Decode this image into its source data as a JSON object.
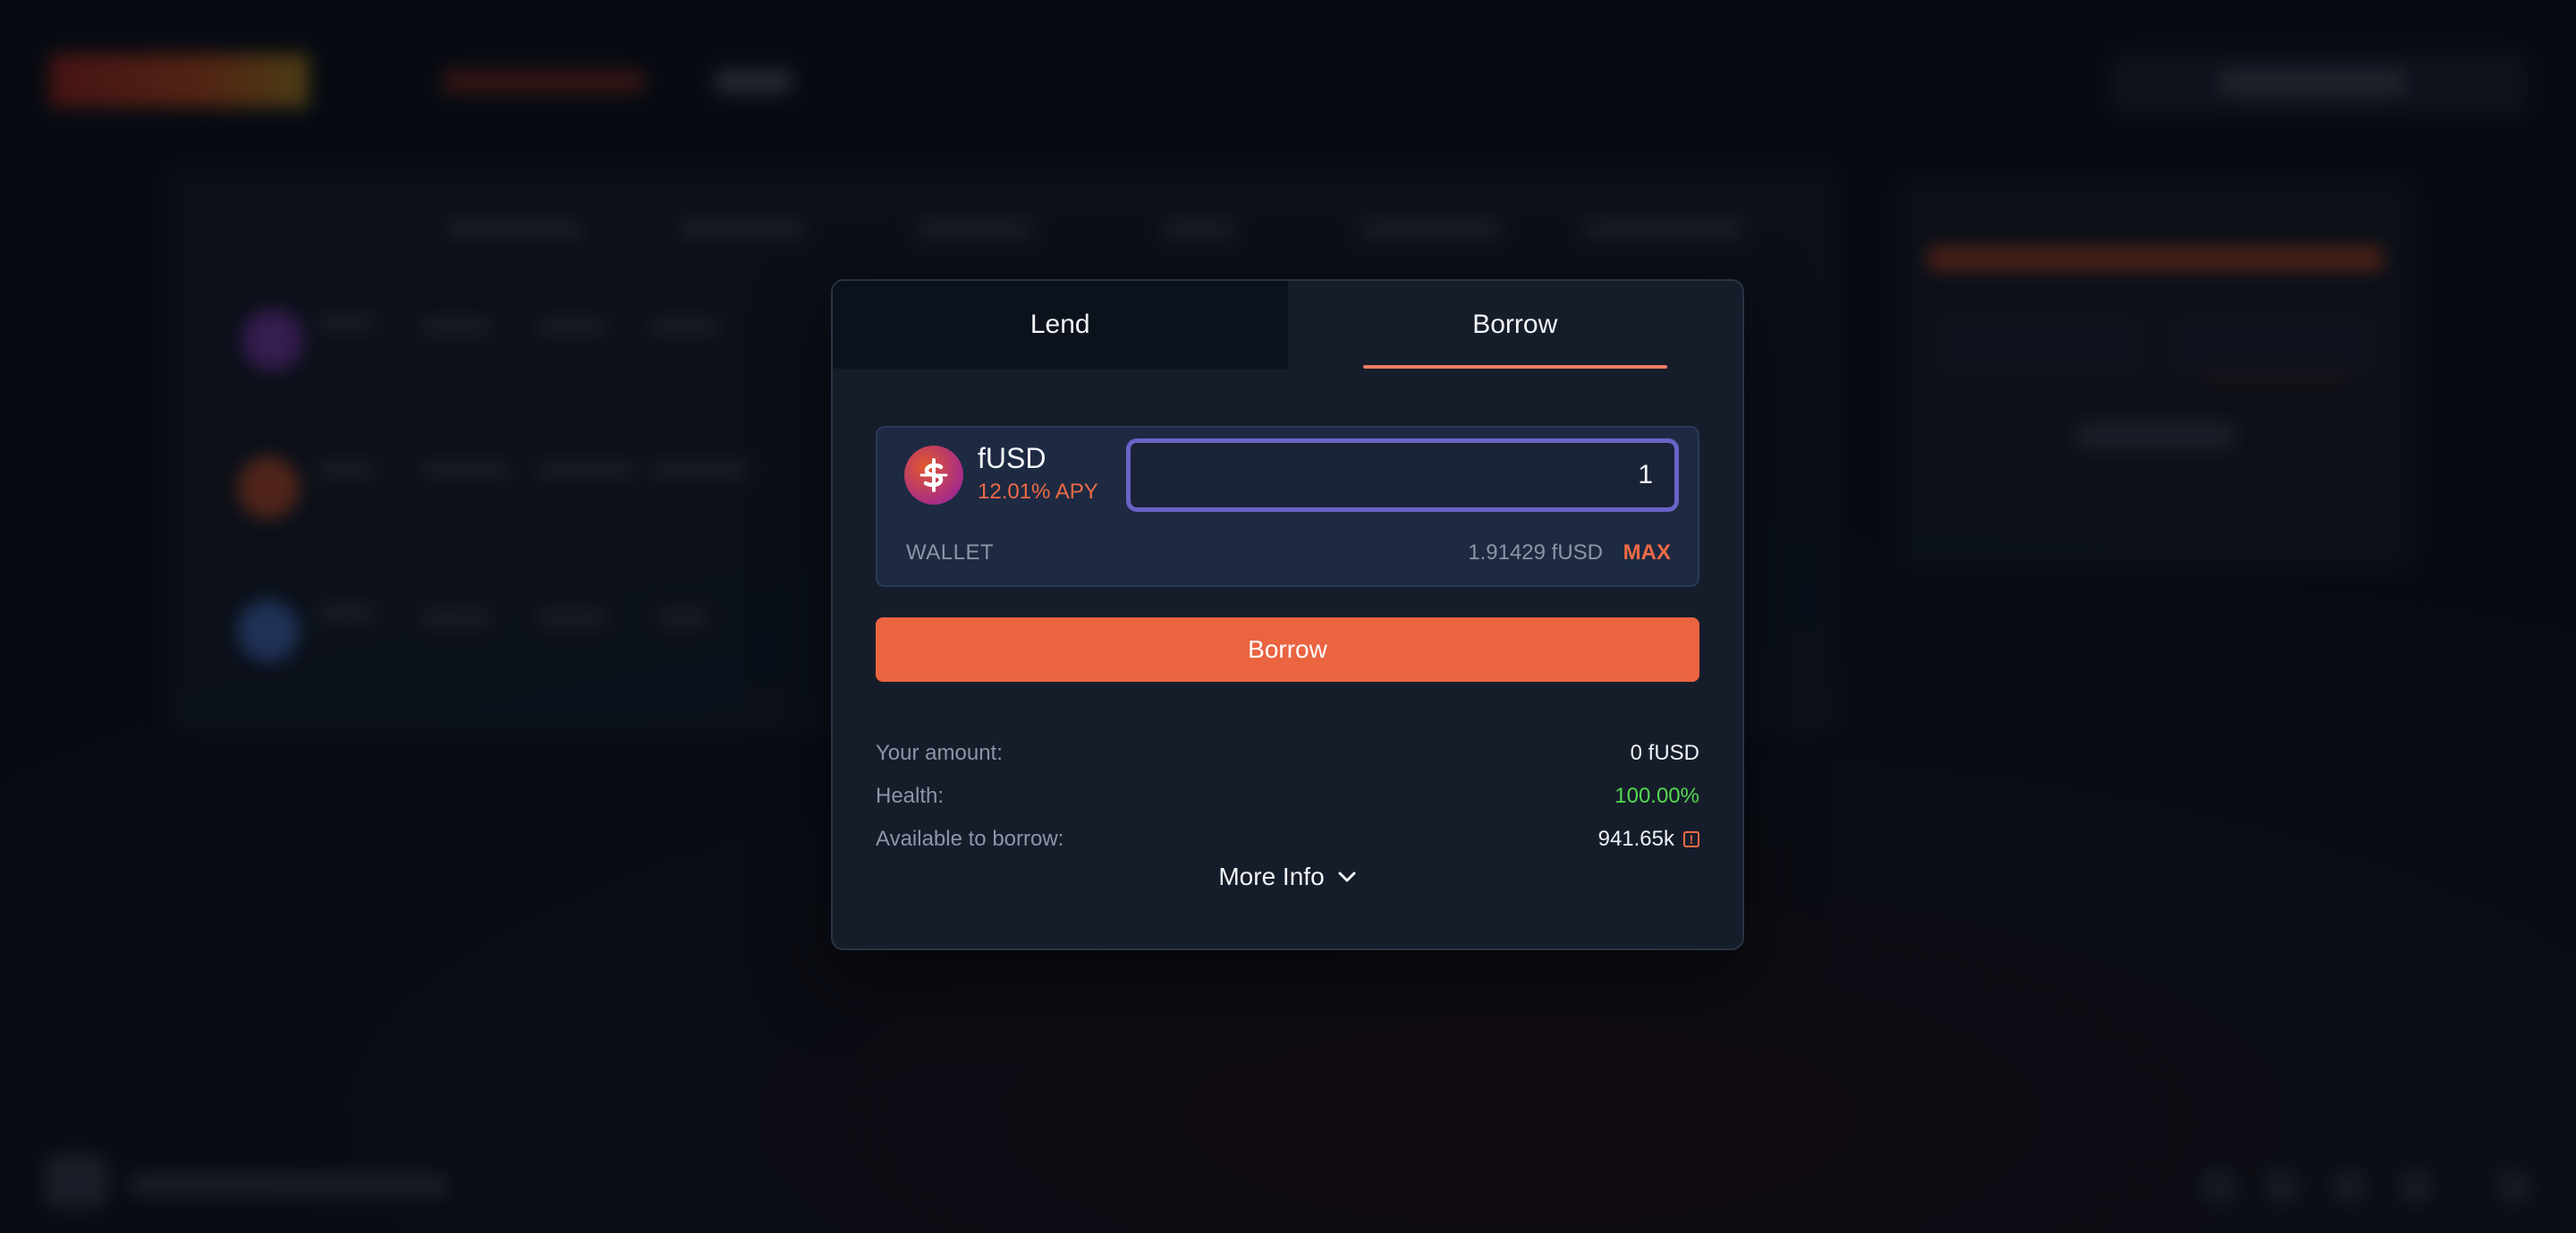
{
  "modal": {
    "tabs": [
      {
        "label": "Lend",
        "active": false
      },
      {
        "label": "Borrow",
        "active": true
      }
    ],
    "asset": {
      "symbol": "fUSD",
      "apy": "12.01% APY",
      "icon": "fusd-dollar-icon"
    },
    "amount_input": {
      "value": "1"
    },
    "wallet": {
      "label": "WALLET",
      "balance": "1.91429 fUSD",
      "max_label": "MAX"
    },
    "action_button": "Borrow",
    "info": {
      "your_amount_label": "Your amount:",
      "your_amount_value": "0 fUSD",
      "health_label": "Health:",
      "health_value": "100.00%",
      "available_label": "Available to borrow:",
      "available_value": "941.65k",
      "available_icon": "alert-square-icon"
    },
    "more_info": "More Info",
    "more_info_icon": "chevron-down-icon"
  },
  "colors": {
    "accent": "#ea6440",
    "apy": "#ee6a46",
    "health": "#54d94f",
    "input_border": "#6a63c6",
    "tab_underline": "#ef7c66"
  }
}
